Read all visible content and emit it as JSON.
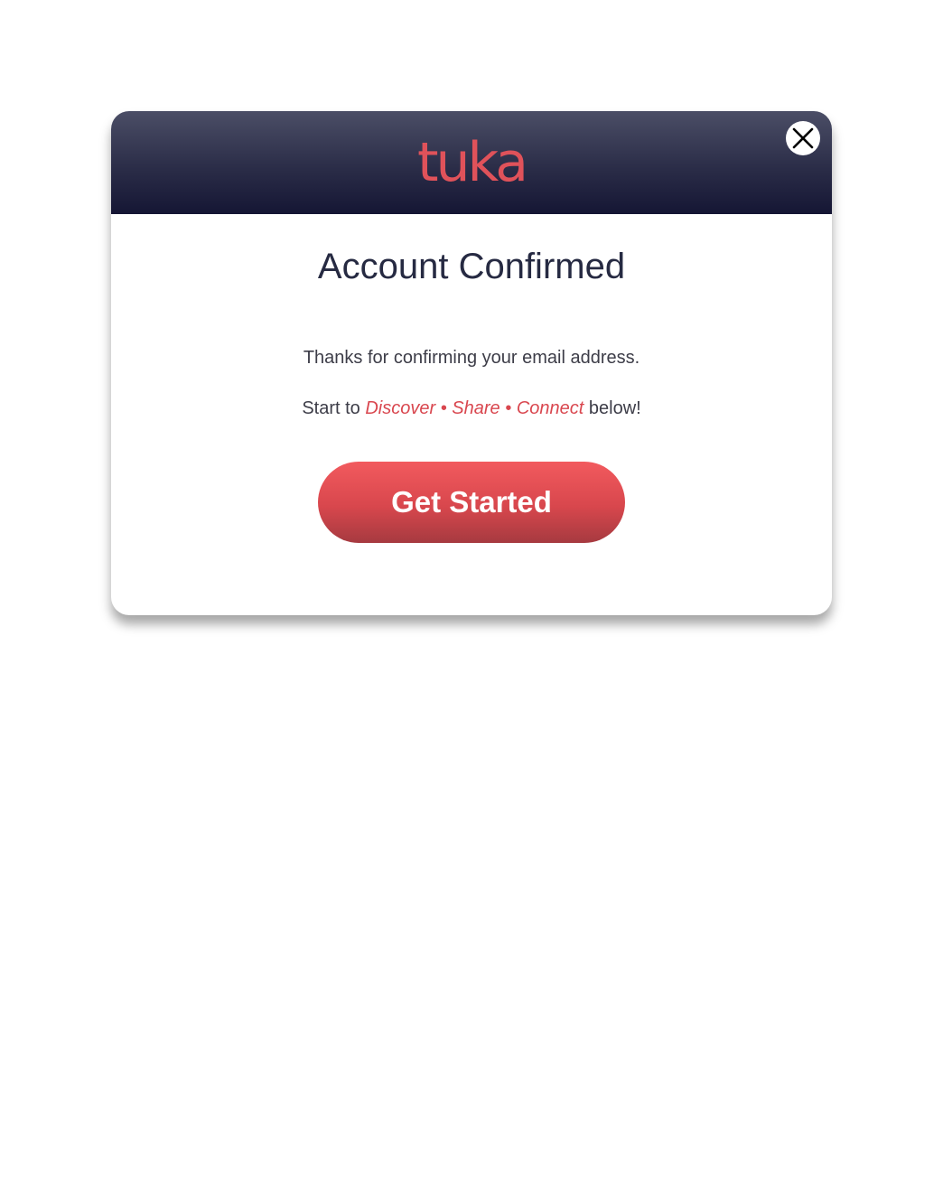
{
  "header": {
    "logo_text": "tuka",
    "close_icon": "close-icon"
  },
  "content": {
    "title": "Account Confirmed",
    "thanks_text": "Thanks for confirming your email address.",
    "start_prefix": "Start to",
    "discover": "Discover",
    "separator": "•",
    "share": "Share",
    "connect": "Connect",
    "start_suffix": "below!"
  },
  "button": {
    "label": "Get Started"
  },
  "colors": {
    "accent": "#e0525a",
    "header_dark": "#151634",
    "title_text": "#262a42"
  }
}
